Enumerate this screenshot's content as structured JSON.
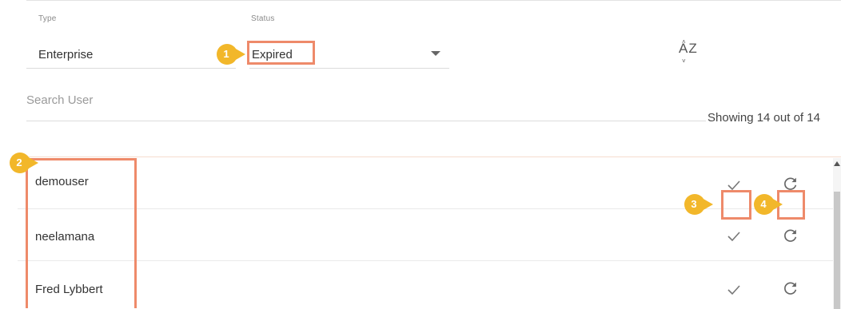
{
  "filters": {
    "type_label": "Type",
    "type_value": "Enterprise",
    "status_label": "Status",
    "status_value": "Expired"
  },
  "sort": {
    "letters": "AZ",
    "icon": "sort-az-icon"
  },
  "search": {
    "placeholder": "Search User"
  },
  "showing_text": "Showing 14 out of 14",
  "users": [
    {
      "name": "demouser"
    },
    {
      "name": "neelamana"
    },
    {
      "name": "Fred Lybbert"
    }
  ],
  "callouts": [
    "1",
    "2",
    "3",
    "4"
  ],
  "colors": {
    "callout": "#f2b72a",
    "highlight": "#ee8a6a"
  }
}
